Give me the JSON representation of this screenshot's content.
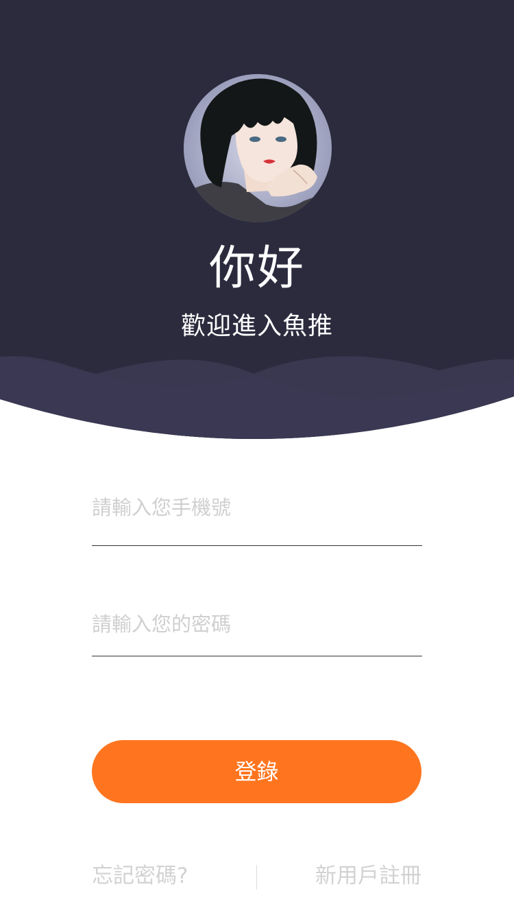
{
  "header": {
    "greeting": "你好",
    "welcome": "歡迎進入魚推"
  },
  "form": {
    "phone_placeholder": "請輸入您手機號",
    "password_placeholder": "請輸入您的密碼",
    "login_label": "登錄"
  },
  "footer": {
    "forgot_label": "忘記密碼?",
    "register_label": "新用戶註冊"
  },
  "colors": {
    "header_bg": "#2c2b3e",
    "wave": "#3a3850",
    "accent": "#ff751f",
    "placeholder": "#cfcfcf"
  },
  "icons": {
    "avatar": "avatar-illustration"
  }
}
